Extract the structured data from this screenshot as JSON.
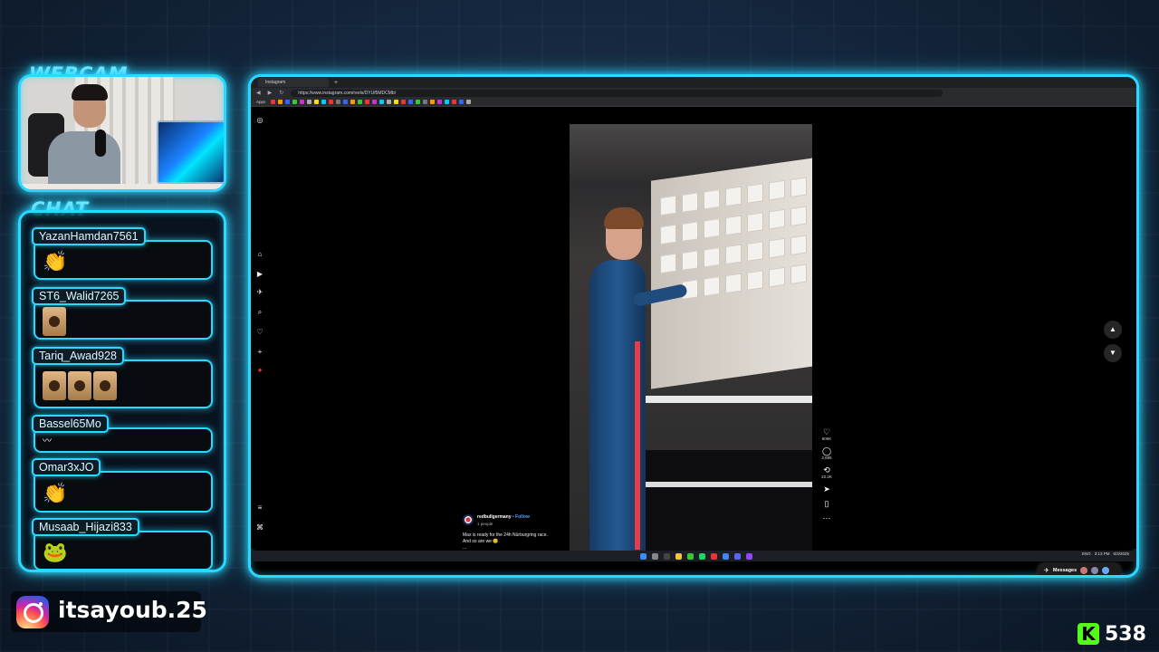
{
  "overlay": {
    "webcam_title": "WEBCAM",
    "chat_title": "CHAT",
    "instagram_handle": "itsayoub.25",
    "kick_viewers": "538",
    "kick_logo_letter": "K",
    "accent_color": "#29d9ff"
  },
  "chat": {
    "messages": [
      {
        "user": "YazanHamdan7561",
        "emote": "clapping-hands"
      },
      {
        "user": "ST6_Walid7265",
        "emote": "custom-emote"
      },
      {
        "user": "Tariq_Awad928",
        "emote": "cat-emotes-x3"
      },
      {
        "user": "Bassel65Mo",
        "emote": "small-emote"
      },
      {
        "user": "Omar3xJO",
        "emote": "clapping-hands"
      },
      {
        "user": "Musaab_Hijazi833",
        "emote": "frog-emote"
      }
    ]
  },
  "browser": {
    "tab_title": "Instagram",
    "new_tab": "+",
    "url": "https://www.instagram.com/reels/DYUf5MDCMb/",
    "bookmarks_label": "Apps"
  },
  "reel": {
    "username": "redbullgermany",
    "follow": "• Follow",
    "meta": "1 people",
    "caption_line1": "Max is ready for the 24h Nürburgring race.",
    "caption_line2": "And so are we 😊",
    "caption_more": "...",
    "likes": "605K",
    "comments": "2,685",
    "reposts": "22.2K",
    "messages_label": "Messages"
  },
  "taskbar": {
    "lang": "ENG",
    "time": "3:13 PM",
    "date": "6/3/2025"
  }
}
